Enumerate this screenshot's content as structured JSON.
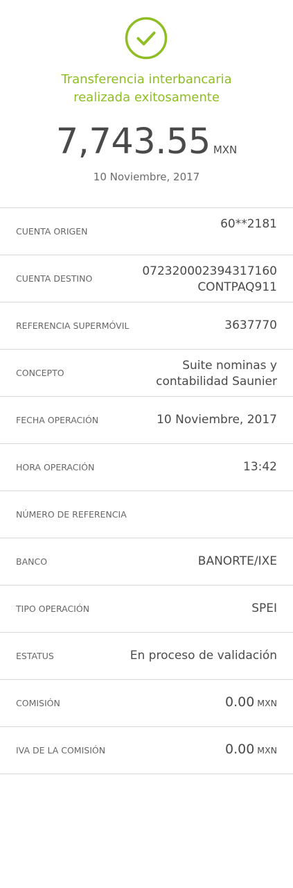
{
  "header": {
    "status_icon": "check-circle-icon",
    "accent_color": "#8fbe24",
    "title_line1": "Transferencia interbancaria",
    "title_line2": "realizada exitosamente",
    "amount": "7,743.55",
    "currency": "MXN",
    "date": "10 Noviembre, 2017"
  },
  "details": {
    "cuenta_origen": {
      "label": "CUENTA ORIGEN",
      "value": "60**2181"
    },
    "cuenta_destino": {
      "label": "CUENTA DESTINO",
      "value_line1": "072320002394317160",
      "value_line2": "CONTPAQ911"
    },
    "referencia_supermovil": {
      "label": "REFERENCIA SUPERMÓVIL",
      "value": "3637770"
    },
    "concepto": {
      "label": "CONCEPTO",
      "value_line1": "Suite nominas y",
      "value_line2": "contabilidad Saunier"
    },
    "fecha_operacion": {
      "label": "FECHA OPERACIÓN",
      "value": "10 Noviembre, 2017"
    },
    "hora_operacion": {
      "label": "HORA OPERACIÓN",
      "value": "13:42"
    },
    "numero_referencia": {
      "label": "NÚMERO DE REFERENCIA",
      "value": ""
    },
    "banco": {
      "label": "BANCO",
      "value": "BANORTE/IXE"
    },
    "tipo_operacion": {
      "label": "TIPO OPERACIÓN",
      "value": "SPEI"
    },
    "estatus": {
      "label": "ESTATUS",
      "value": "En proceso de validación"
    },
    "comision": {
      "label": "COMISIÓN",
      "amount": "0.00",
      "currency": "MXN"
    },
    "iva_comision": {
      "label": "IVA DE LA COMISIÓN",
      "amount": "0.00",
      "currency": "MXN"
    }
  }
}
